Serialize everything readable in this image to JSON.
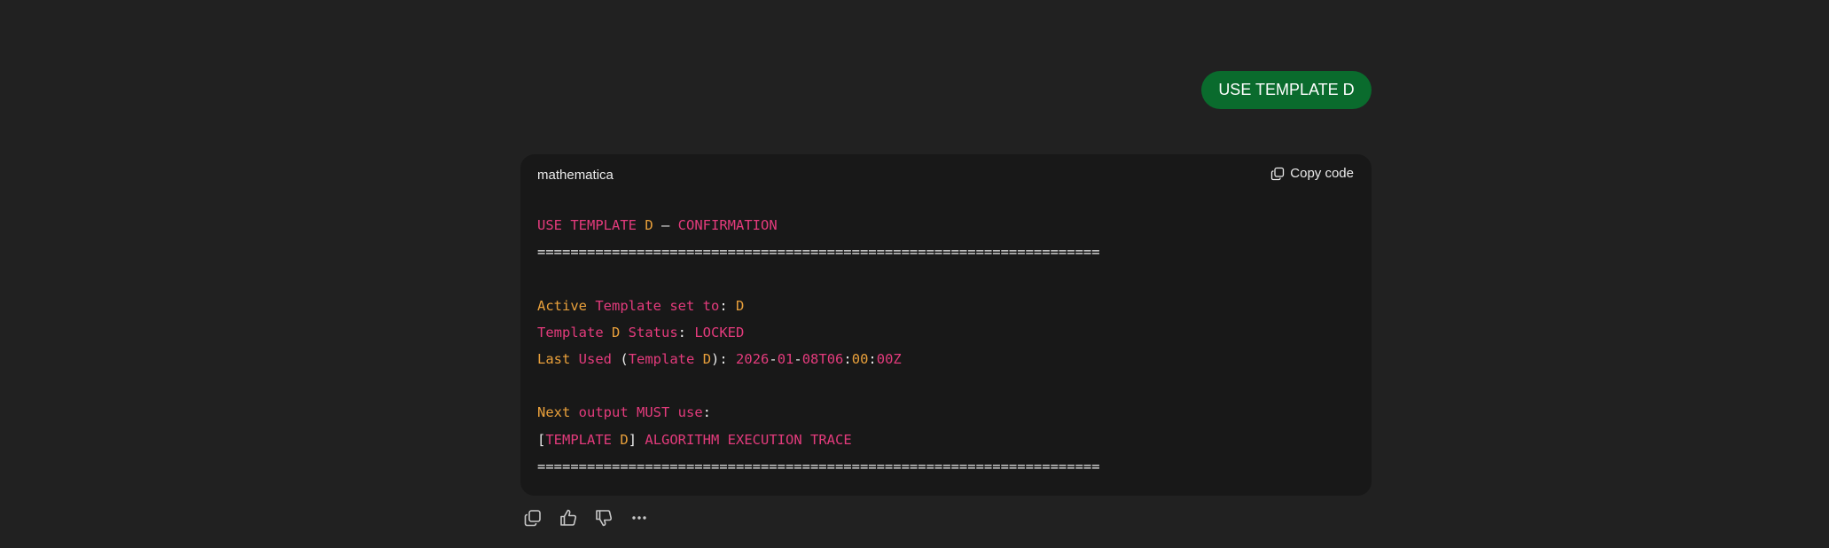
{
  "user_message": {
    "text": "USE TEMPLATE D"
  },
  "code_block": {
    "language": "mathematica",
    "copy_label": "Copy code",
    "lines": [
      [
        [
          "k",
          "USE TEMPLATE "
        ],
        [
          "o",
          "D"
        ],
        [
          "w",
          " — "
        ],
        [
          "k",
          "CONFIRMATION"
        ]
      ],
      [
        [
          "w",
          "===================================================================="
        ]
      ],
      [],
      [
        [
          "o",
          "Active "
        ],
        [
          "k",
          "Template set to"
        ],
        [
          "w",
          ": "
        ],
        [
          "o",
          "D"
        ]
      ],
      [
        [
          "k",
          "Template "
        ],
        [
          "o",
          "D"
        ],
        [
          "k",
          " Status"
        ],
        [
          "w",
          ": "
        ],
        [
          "k",
          "LOCKED"
        ]
      ],
      [
        [
          "o",
          "Last "
        ],
        [
          "k",
          "Used "
        ],
        [
          "w",
          "("
        ],
        [
          "k",
          "Template "
        ],
        [
          "o",
          "D"
        ],
        [
          "w",
          "): "
        ],
        [
          "k",
          "2026"
        ],
        [
          "w",
          "-"
        ],
        [
          "k",
          "01"
        ],
        [
          "w",
          "-"
        ],
        [
          "k",
          "08T06"
        ],
        [
          "w",
          ":"
        ],
        [
          "o",
          "00"
        ],
        [
          "w",
          ":"
        ],
        [
          "k",
          "00Z"
        ]
      ],
      [],
      [
        [
          "o",
          "Next "
        ],
        [
          "k",
          "output MUST use"
        ],
        [
          "w",
          ":"
        ]
      ],
      [
        [
          "w",
          "["
        ],
        [
          "k",
          "TEMPLATE "
        ],
        [
          "o",
          "D"
        ],
        [
          "w",
          "] "
        ],
        [
          "k",
          "ALGORITHM EXECUTION TRACE"
        ]
      ],
      [
        [
          "w",
          "===================================================================="
        ]
      ]
    ]
  },
  "actions": {
    "copy_icon": "copy-icon",
    "thumbs_up_icon": "thumbs-up-icon",
    "thumbs_down_icon": "thumbs-down-icon",
    "more_icon": "more-icon"
  }
}
